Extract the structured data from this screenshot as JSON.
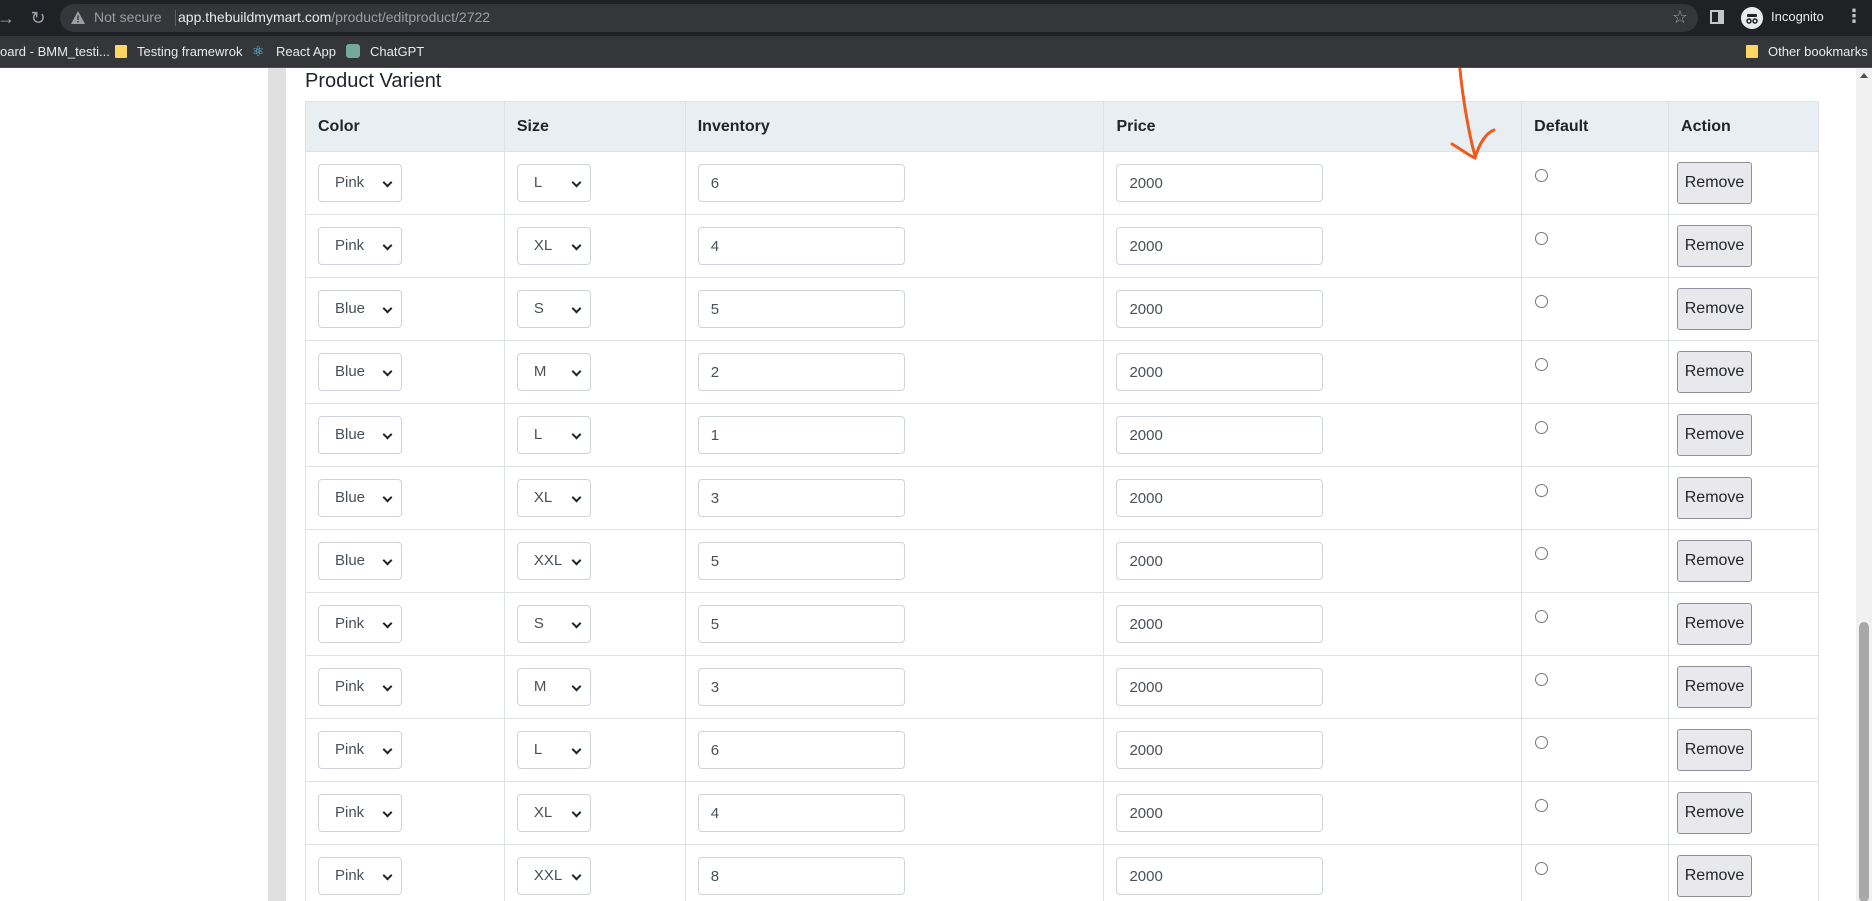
{
  "browser": {
    "not_secure_label": "Not secure",
    "url_host": "app.thebuildmymart.com",
    "url_path": "/product/editproduct/2722",
    "incognito_label": "Incognito",
    "bookmarks": [
      {
        "label": "oard - BMM_testi...",
        "icon": "none"
      },
      {
        "label": "Testing framewrok",
        "icon": "folder-icon"
      },
      {
        "label": "React App",
        "icon": "react-icon"
      },
      {
        "label": "ChatGPT",
        "icon": "chatgpt-icon"
      }
    ],
    "other_bookmarks_label": "Other bookmarks"
  },
  "section": {
    "title": "Product Varient",
    "columns": [
      "Color",
      "Size",
      "Inventory",
      "Price",
      "Default",
      "Action"
    ]
  },
  "variants": [
    {
      "color": "Pink",
      "size": "L",
      "inventory": "6",
      "price": "2000"
    },
    {
      "color": "Pink",
      "size": "XL",
      "inventory": "4",
      "price": "2000"
    },
    {
      "color": "Blue",
      "size": "S",
      "inventory": "5",
      "price": "2000"
    },
    {
      "color": "Blue",
      "size": "M",
      "inventory": "2",
      "price": "2000"
    },
    {
      "color": "Blue",
      "size": "L",
      "inventory": "1",
      "price": "2000"
    },
    {
      "color": "Blue",
      "size": "XL",
      "inventory": "3",
      "price": "2000"
    },
    {
      "color": "Blue",
      "size": "XXL",
      "inventory": "5",
      "price": "2000"
    },
    {
      "color": "Pink",
      "size": "S",
      "inventory": "5",
      "price": "2000"
    },
    {
      "color": "Pink",
      "size": "M",
      "inventory": "3",
      "price": "2000"
    },
    {
      "color": "Pink",
      "size": "L",
      "inventory": "6",
      "price": "2000"
    },
    {
      "color": "Pink",
      "size": "XL",
      "inventory": "4",
      "price": "2000"
    },
    {
      "color": "Pink",
      "size": "XXL",
      "inventory": "8",
      "price": "2000"
    }
  ],
  "remove_label": "Remove",
  "colors": {
    "annotation": "#f05a1a",
    "header_bg": "#e8eef1"
  }
}
